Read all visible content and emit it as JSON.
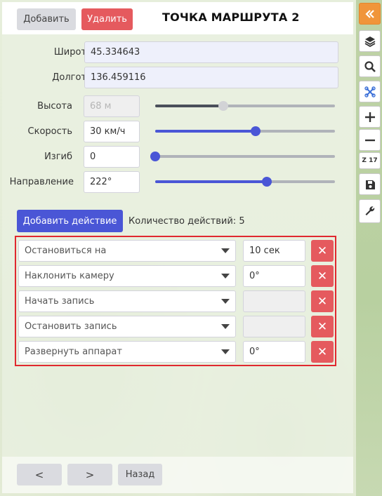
{
  "header": {
    "add_label": "Добавить",
    "delete_label": "Удалить",
    "title": "ТОЧКА МАРШРУТА 2"
  },
  "fields": {
    "latitude": {
      "label": "Широта",
      "value": "45.334643"
    },
    "longitude": {
      "label": "Долгота",
      "value": "136.459116"
    },
    "altitude": {
      "label": "Высота",
      "value": "68 м",
      "slider_fraction": 0.38
    },
    "speed": {
      "label": "Скорость",
      "value": "30 км/ч",
      "slider_fraction": 0.56
    },
    "bend": {
      "label": "Изгиб",
      "value": "0",
      "slider_fraction": 0.0
    },
    "heading": {
      "label": "Направление",
      "value": "222°",
      "slider_fraction": 0.62
    }
  },
  "actions": {
    "add_label": "Добавить действие",
    "count_text": "Количество действий: 5",
    "items": [
      {
        "type": "Остановиться на",
        "param": "10 сек"
      },
      {
        "type": "Наклонить камеру",
        "param": "0°"
      },
      {
        "type": "Начать запись",
        "param": ""
      },
      {
        "type": "Остановить запись",
        "param": ""
      },
      {
        "type": "Развернуть аппарат",
        "param": "0°"
      }
    ],
    "delete_glyph": "✕"
  },
  "footer": {
    "prev_glyph": "<",
    "next_glyph": ">",
    "back_label": "Назад"
  },
  "sidebar": {
    "zoom_label": "Z 17",
    "icons": [
      "collapse-icon",
      "layers-icon",
      "search-icon",
      "drone-icon",
      "zoom-in-icon",
      "zoom-out-icon",
      "zoom-level",
      "save-icon",
      "wrench-icon"
    ],
    "accent_color": "#f0953a"
  },
  "colors": {
    "primary": "#4a56d6",
    "danger": "#e55a5e",
    "highlight_border": "#e0282f"
  }
}
